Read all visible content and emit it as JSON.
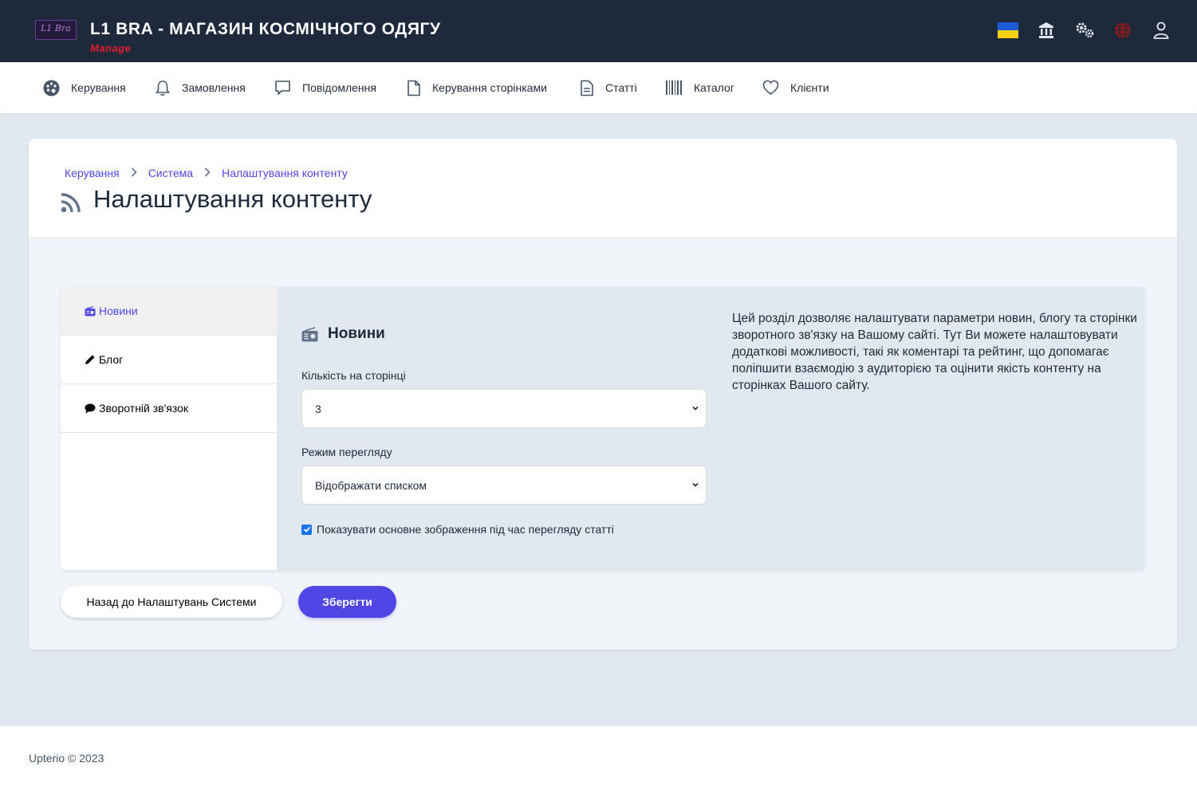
{
  "header": {
    "logo_text": "L1 Bra",
    "title": "L1 BRA - МАГАЗИН КОСМІЧНОГО ОДЯГУ",
    "subtitle": "Manage",
    "icons": [
      "ukraine-flag-icon",
      "bank-icon",
      "gears-icon",
      "globe-icon",
      "user-icon"
    ]
  },
  "nav": {
    "items": [
      {
        "label": "Керування",
        "icon": "palette-icon"
      },
      {
        "label": "Замовлення",
        "icon": "bell-icon"
      },
      {
        "label": "Повідомлення",
        "icon": "message-icon"
      },
      {
        "label": "Керування сторінками",
        "icon": "page-icon"
      },
      {
        "label": "Статті",
        "icon": "document-icon"
      },
      {
        "label": "Каталог",
        "icon": "barcode-icon"
      },
      {
        "label": "Клієнти",
        "icon": "heart-icon"
      }
    ]
  },
  "breadcrumb": [
    "Керування",
    "Система",
    "Налаштування контенту"
  ],
  "page": {
    "title": "Налаштування контенту"
  },
  "tabs": [
    {
      "label": "Новини",
      "icon": "radio-icon",
      "active": true
    },
    {
      "label": "Блог",
      "icon": "pencil-icon",
      "active": false
    },
    {
      "label": "Зворотній зв'язок",
      "icon": "comment-icon",
      "active": false
    }
  ],
  "section": {
    "title": "Новини",
    "per_page_label": "Кількість на сторінці",
    "per_page_value": "3",
    "view_mode_label": "Режим перегляду",
    "view_mode_value": "Відображати списком",
    "show_image_label": "Показувати основне зображення під час перегляду статті",
    "show_image_checked": true,
    "description": "Цей розділ дозволяє налаштувати параметри новин, блогу та сторінки зворотного зв'язку на Вашому сайті. Тут Ви можете налаштовувати додаткові можливості, такі як коментарі та рейтинг, що допомагає поліпшити взаємодію з аудиторією та оцінити якість контенту на сторінках Вашого сайту."
  },
  "buttons": {
    "back": "Назад до Налаштувань Системи",
    "save": "Зберегти"
  },
  "footer": {
    "text": "Upterio © 2023"
  },
  "colors": {
    "header_bg": "#1e293b",
    "accent": "#4f46e5",
    "subtitle": "#e11d2e",
    "page_bg": "#e2e8f0"
  }
}
